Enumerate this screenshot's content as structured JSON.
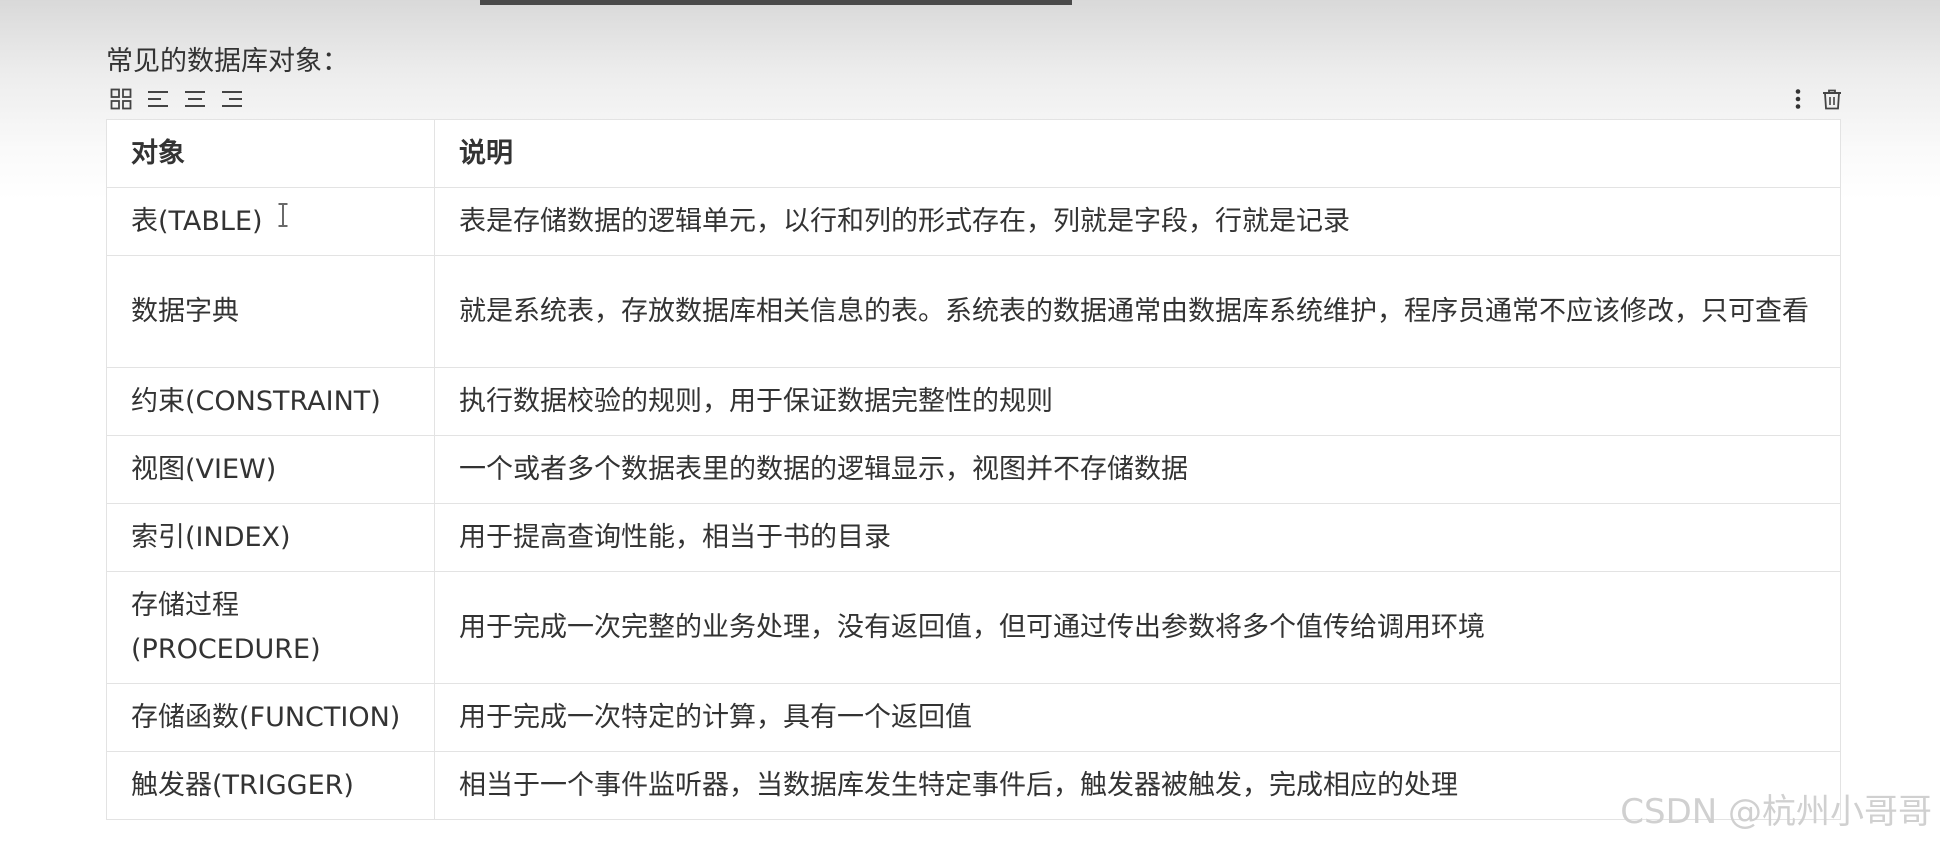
{
  "heading": "常见的数据库对象：",
  "toolbar": {
    "left": [
      {
        "icon": "table-grid-icon"
      },
      {
        "icon": "align-left-icon"
      },
      {
        "icon": "align-center-icon"
      },
      {
        "icon": "align-right-icon"
      }
    ],
    "right": [
      {
        "icon": "more-vertical-icon"
      },
      {
        "icon": "trash-icon"
      }
    ]
  },
  "table": {
    "headers": [
      "对象",
      "说明"
    ],
    "rows": [
      [
        "表(TABLE)",
        "表是存储数据的逻辑单元，以行和列的形式存在，列就是字段，行就是记录"
      ],
      [
        "数据字典",
        "就是系统表，存放数据库相关信息的表。系统表的数据通常由数据库系统维护，程序员通常不应该修改，只可查看"
      ],
      [
        "约束(CONSTRAINT)",
        "执行数据校验的规则，用于保证数据完整性的规则"
      ],
      [
        "视图(VIEW)",
        "一个或者多个数据表里的数据的逻辑显示，视图并不存储数据"
      ],
      [
        "索引(INDEX)",
        "用于提高查询性能，相当于书的目录"
      ],
      [
        "存储过程(PROCEDURE)",
        "用于完成一次完整的业务处理，没有返回值，但可通过传出参数将多个值传给调用环境"
      ],
      [
        "存储函数(FUNCTION)",
        "用于完成一次特定的计算，具有一个返回值"
      ],
      [
        "触发器(TRIGGER)",
        "相当于一个事件监听器，当数据库发生特定事件后，触发器被触发，完成相应的处理"
      ]
    ]
  },
  "watermark": "CSDN @杭州小哥哥"
}
